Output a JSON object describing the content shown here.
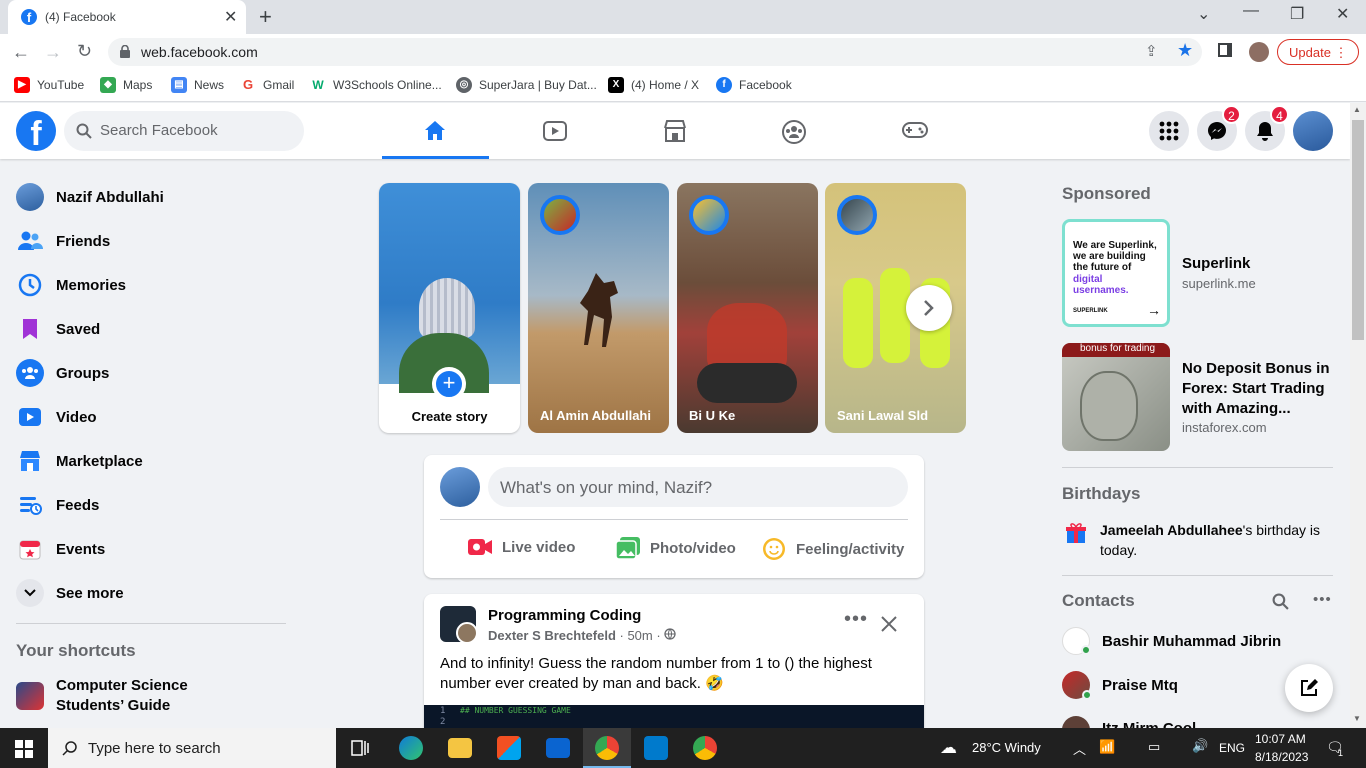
{
  "browser": {
    "tab_title": "(4) Facebook",
    "url": "web.facebook.com",
    "update_label": "Update",
    "bookmarks": [
      {
        "label": "YouTube",
        "icon": "youtube-icon",
        "color": "#ff0000"
      },
      {
        "label": "Maps",
        "icon": "maps-icon",
        "color": "#34a853"
      },
      {
        "label": "News",
        "icon": "news-icon",
        "color": "#4285f4"
      },
      {
        "label": "Gmail",
        "icon": "google-icon",
        "color": "#ea4335"
      },
      {
        "label": "W3Schools Online...",
        "icon": "w3schools-icon",
        "color": "#04aa6d"
      },
      {
        "label": "SuperJara | Buy Dat...",
        "icon": "globe-icon",
        "color": "#5f6368"
      },
      {
        "label": "(4) Home / X",
        "icon": "x-icon",
        "color": "#000000"
      },
      {
        "label": "Facebook",
        "icon": "facebook-icon",
        "color": "#1877f2"
      }
    ]
  },
  "fb": {
    "logo": "f",
    "search_placeholder": "Search Facebook",
    "messenger_badge": "2",
    "notifications_badge": "4",
    "brand_color": "#1877f2"
  },
  "left_menu": {
    "profile_name": "Nazif Abdullahi",
    "items": [
      "Friends",
      "Memories",
      "Saved",
      "Groups",
      "Video",
      "Marketplace",
      "Feeds",
      "Events",
      "See more"
    ],
    "shortcuts_heading": "Your shortcuts",
    "shortcut_1": "Computer Science Students’ Guide"
  },
  "stories": {
    "create_label": "Create story",
    "items": [
      "Al Amin Abdullahi",
      "Bi U Ke",
      "Sani Lawal Sld"
    ]
  },
  "composer": {
    "placeholder": "What's on your mind, Nazif?",
    "live_video": "Live video",
    "photo_video": "Photo/video",
    "feeling": "Feeling/activity"
  },
  "post": {
    "group": "Programming Coding",
    "author": "Dexter S Brechtefeld",
    "time": " · 50m · ",
    "text": "And to infinity! Guess the random number from 1 to () the highest number ever created by man and back. 🤣",
    "code_line_1": "## NUMBER GUESSING GAME"
  },
  "sidebar_right": {
    "sponsored": "Sponsored",
    "ad1_title": "Superlink",
    "ad1_domain": "superlink.me",
    "ad1_img_text": "We are Superlink, we are building the future of",
    "ad1_img_highlight": "digital usernames.",
    "ad1_img_brand": "SUPERLINK",
    "ad2_title": "No Deposit Bonus in Forex: Start Trading with Amazing...",
    "ad2_domain": "instaforex.com",
    "ad2_img_text": "bonus for trading",
    "birthdays": "Birthdays",
    "birthday_name": "Jameelah Abdullahee",
    "birthday_rest": "'s birthday is today.",
    "contacts": "Contacts",
    "contact_list": [
      "Bashir Muhammad Jibrin",
      "Praise Mtq",
      "Itz Mirm Cool"
    ]
  },
  "taskbar": {
    "search_placeholder": "Type here to search",
    "weather": "28°C  Windy",
    "lang": "ENG",
    "time": "10:07 AM",
    "date": "8/18/2023",
    "notif_count": "1"
  }
}
